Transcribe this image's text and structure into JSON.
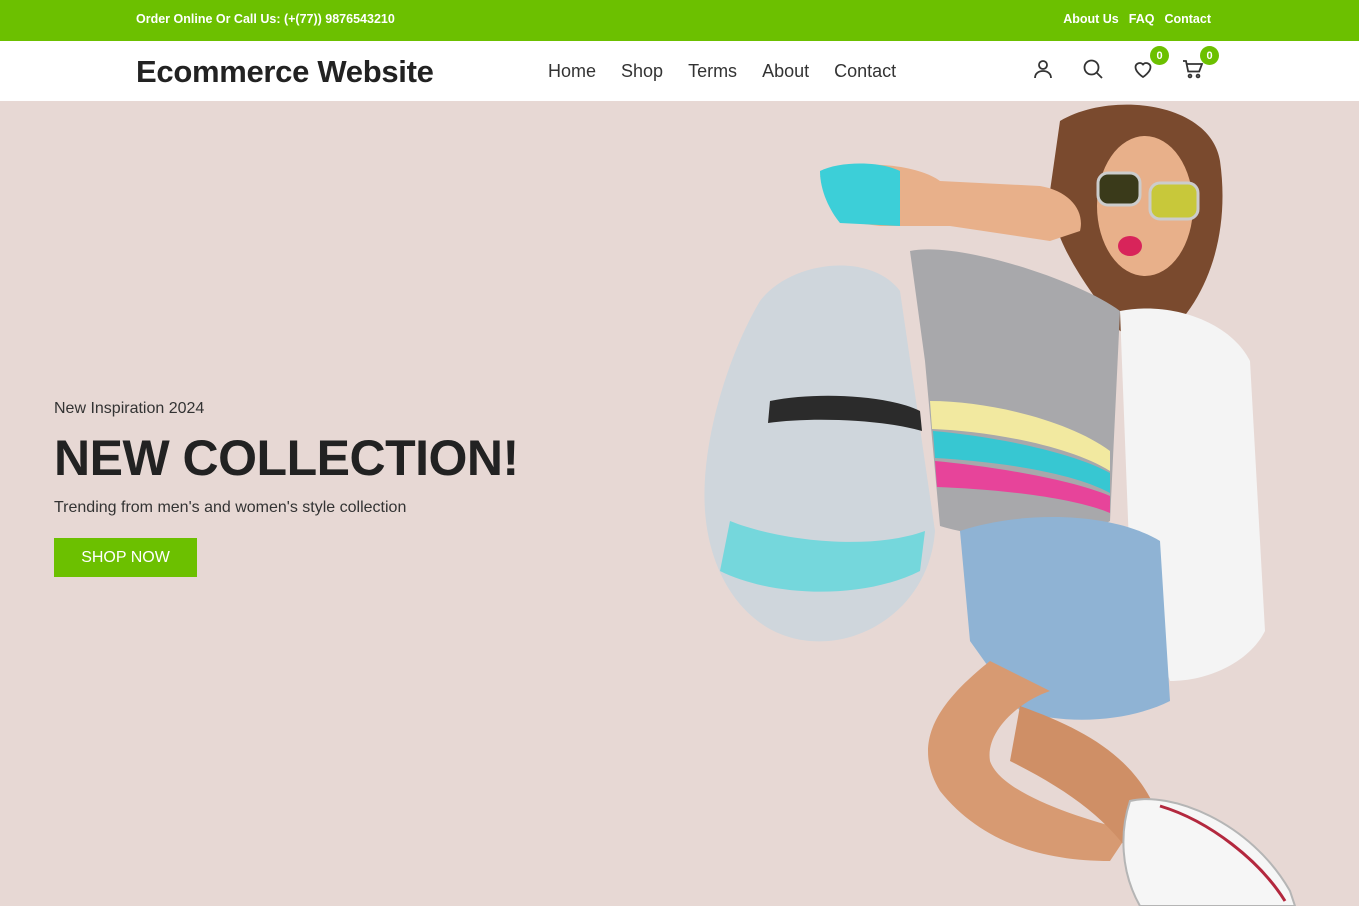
{
  "topbar": {
    "contact_text": "Order Online Or Call Us: (+(77)) 9876543210",
    "links": [
      "About Us",
      "FAQ",
      "Contact"
    ]
  },
  "header": {
    "logo": "Ecommerce Website",
    "nav": [
      "Home",
      "Shop",
      "Terms",
      "About",
      "Contact"
    ],
    "icons": {
      "account": "user-icon",
      "search": "search-icon",
      "wishlist": "heart-icon",
      "cart": "cart-icon"
    },
    "wishlist_count": "0",
    "cart_count": "0"
  },
  "hero": {
    "eyebrow": "New Inspiration 2024",
    "headline": "NEW COLLECTION!",
    "subline": "Trending from men's and women's style collection",
    "cta_label": "SHOP NOW"
  },
  "colors": {
    "accent": "#6cc000",
    "hero_bg": "#e7d8d4",
    "text_dark": "#222222"
  }
}
